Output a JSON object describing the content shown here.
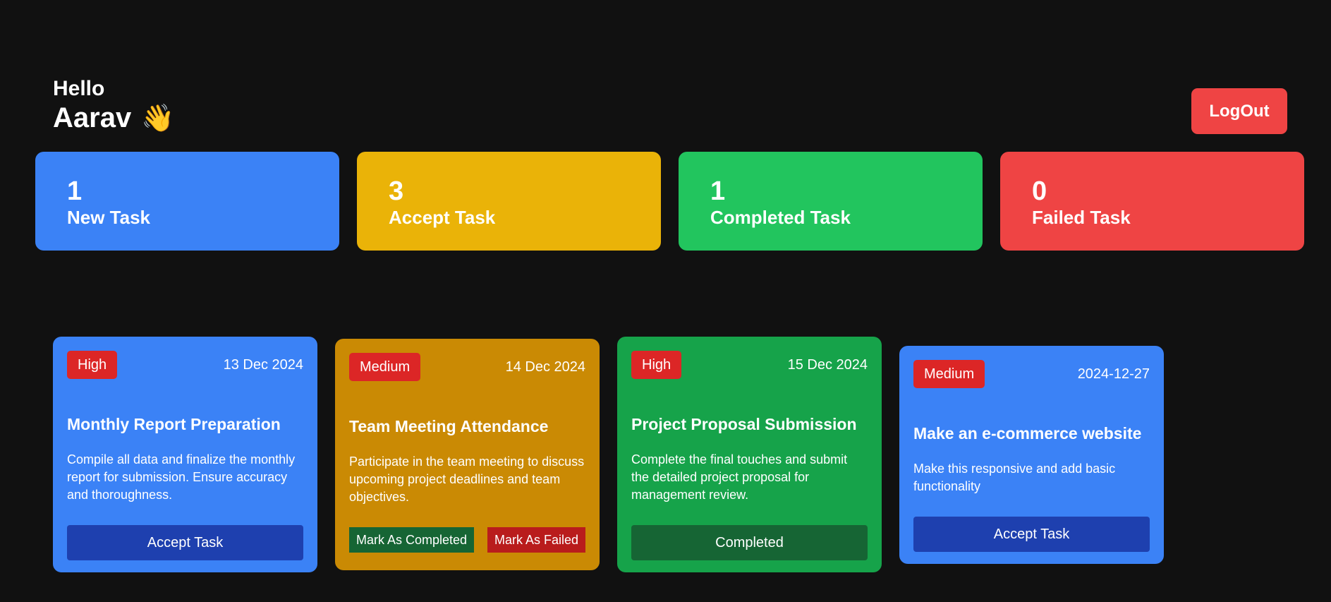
{
  "header": {
    "hello": "Hello",
    "name": "Aarav",
    "wave_emoji": "👋",
    "logout_label": "LogOut"
  },
  "stats": [
    {
      "count": "1",
      "label": "New Task",
      "color": "#3b82f6"
    },
    {
      "count": "3",
      "label": "Accept Task",
      "color": "#eab308"
    },
    {
      "count": "1",
      "label": "Completed Task",
      "color": "#22c55e"
    },
    {
      "count": "0",
      "label": "Failed Task",
      "color": "#ef4444"
    }
  ],
  "tasks": [
    {
      "priority": "High",
      "date": "13 Dec 2024",
      "title": "Monthly Report Preparation",
      "description": "Compile all data and finalize the monthly report for submission. Ensure accuracy and thoroughness.",
      "action_label": "Accept Task",
      "color": "#3b82f6",
      "button_color": "#1e40af"
    },
    {
      "priority": "Medium",
      "date": "14 Dec 2024",
      "title": "Team Meeting Attendance",
      "description": "Participate in the team meeting to discuss upcoming project deadlines and team objectives.",
      "complete_label": "Mark As Completed",
      "failed_label": "Mark As Failed",
      "color": "#ca8a04",
      "complete_color": "#166534",
      "failed_color": "#b91c1c"
    },
    {
      "priority": "High",
      "date": "15 Dec 2024",
      "title": "Project Proposal Submission",
      "description": "Complete the final touches and submit the detailed project proposal for management review.",
      "action_label": "Completed",
      "color": "#16a34a",
      "button_color": "#166534"
    },
    {
      "priority": "Medium",
      "date": "2024-12-27",
      "title": "Make an e-commerce website",
      "description": "Make this responsive and add basic functionality",
      "action_label": "Accept Task",
      "color": "#3b82f6",
      "button_color": "#1e40af"
    }
  ]
}
